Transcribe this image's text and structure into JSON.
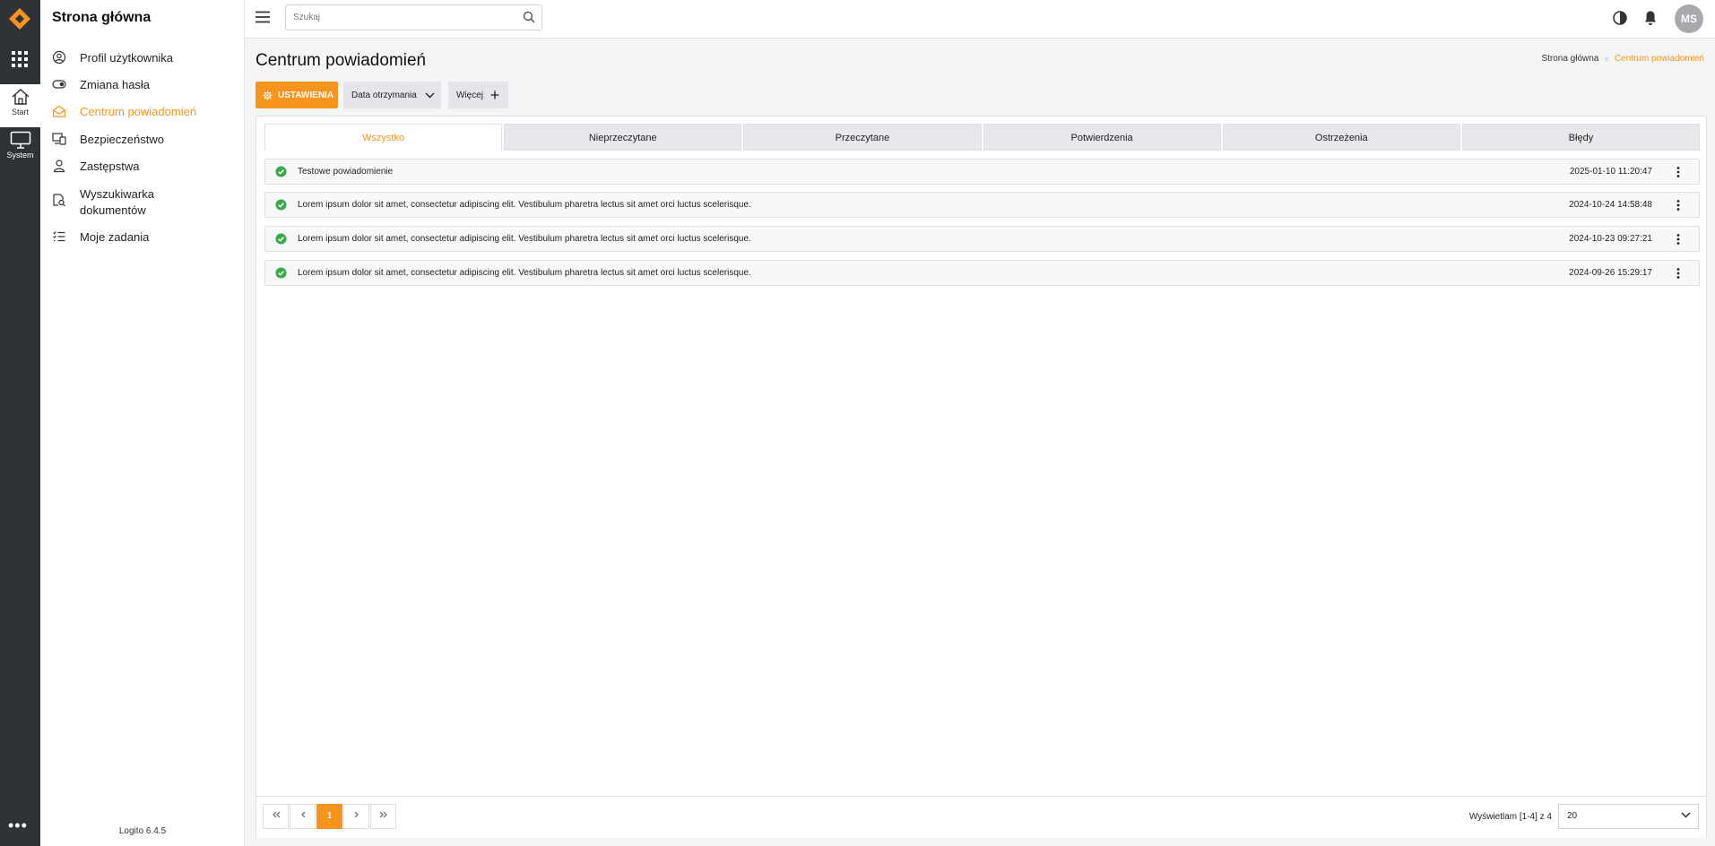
{
  "rail": {
    "items": [
      {
        "label": "Start"
      },
      {
        "label": "System"
      }
    ]
  },
  "sidemenu": {
    "title": "Strona główna",
    "items": [
      {
        "label": "Profil użytkownika",
        "icon": "user-circle-icon"
      },
      {
        "label": "Zmiana hasła",
        "icon": "toggle-icon"
      },
      {
        "label": "Centrum powiadomień",
        "icon": "envelope-open-icon",
        "active": true
      },
      {
        "label": "Bezpieczeństwo",
        "icon": "devices-icon"
      },
      {
        "label": "Zastępstwa",
        "icon": "person-icon"
      },
      {
        "label": "Wyszukiwarka dokumentów",
        "icon": "document-search-icon"
      },
      {
        "label": "Moje zadania",
        "icon": "task-list-icon"
      }
    ],
    "version": "Logito 6.4.5"
  },
  "topbar": {
    "search_placeholder": "Szukaj",
    "avatar_initials": "MS"
  },
  "page": {
    "title": "Centrum powiadomień",
    "breadcrumb": {
      "home": "Strona główna",
      "current": "Centrum powiadomień"
    }
  },
  "toolbar": {
    "settings_label": "USTAWIENIA",
    "sort_label": "Data otrzymania",
    "more_label": "Więcej"
  },
  "tabs": [
    "Wszystko",
    "Nieprzeczytane",
    "Przeczytane",
    "Potwierdzenia",
    "Ostrzeżenia",
    "Błędy"
  ],
  "active_tab": "Wszystko",
  "notifications": [
    {
      "text": "Testowe powiadomienie",
      "date": "2025-01-10 11:20:47"
    },
    {
      "text": "Lorem ipsum dolor sit amet, consectetur adipiscing elit. Vestibulum pharetra lectus sit amet orci luctus scelerisque.",
      "date": "2024-10-24 14:58:48"
    },
    {
      "text": "Lorem ipsum dolor sit amet, consectetur adipiscing elit. Vestibulum pharetra lectus sit amet orci luctus scelerisque.",
      "date": "2024-10-23 09:27:21"
    },
    {
      "text": "Lorem ipsum dolor sit amet, consectetur adipiscing elit. Vestibulum pharetra lectus sit amet orci luctus scelerisque.",
      "date": "2024-09-26 15:29:17"
    }
  ],
  "pager": {
    "current_page": "1",
    "info": "Wyświetlam [1-4] z 4",
    "page_size": "20"
  },
  "colors": {
    "accent": "#f7941d",
    "rail": "#2f3237",
    "success": "#3aa84b"
  }
}
